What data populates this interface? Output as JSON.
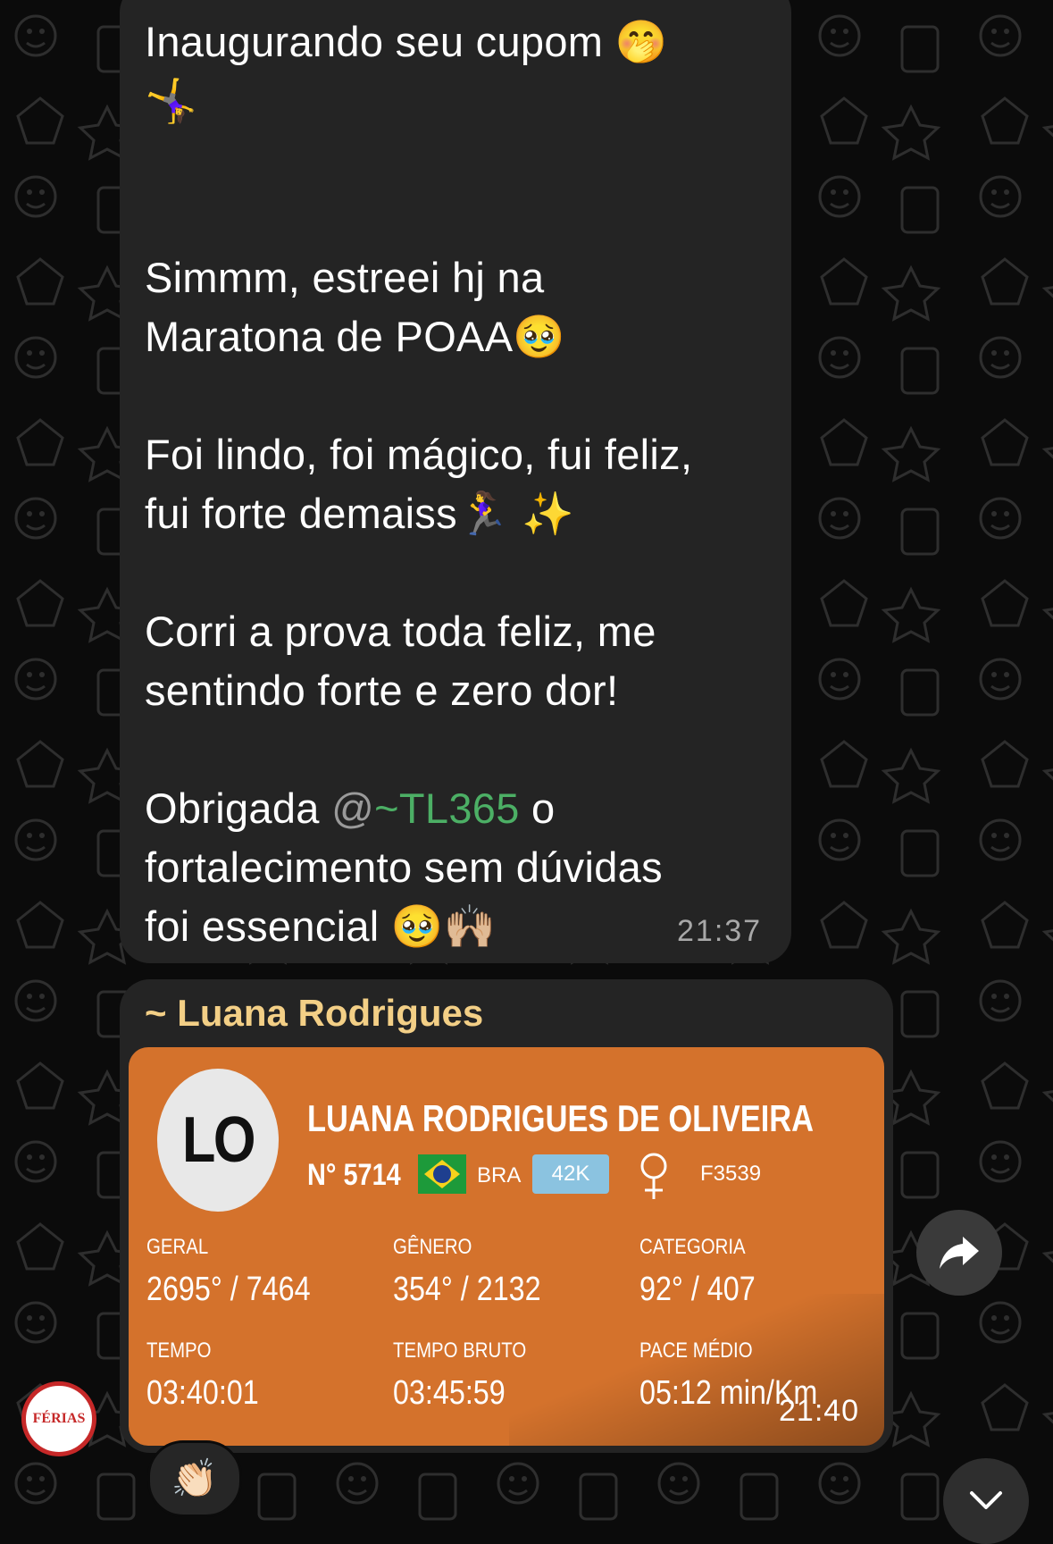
{
  "message1": {
    "line_1": "Inaugurando seu cupom 🤭",
    "line_2": "🤸‍♀️",
    "line_3": "Simmm, estreei hj na",
    "line_4": "Maratona de POAA🥹",
    "line_5": "Foi lindo, foi mágico, fui feliz,",
    "line_6": "fui forte demaiss🏃‍♀️ ✨",
    "line_7": "Corri a prova toda feliz, me",
    "line_8": "sentindo forte e zero dor!",
    "line_9_prefix": "Obrigada ",
    "mention_at": "@",
    "mention_name": "~TL365",
    "line_9_suffix": " o",
    "line_10": "fortalecimento sem dúvidas",
    "line_11": "foi essencial 🥹🙌🏼",
    "time": "21:37"
  },
  "message2": {
    "sender": "~ Luana Rodrigues",
    "time": "21:40",
    "reaction": "👏🏻",
    "card": {
      "initials": "LO",
      "name": "LUANA RODRIGUES DE OLIVEIRA",
      "bib": "N° 5714",
      "country": "BRA",
      "distance": "42K",
      "category_code": "F3539",
      "stats": {
        "geral_label": "GERAL",
        "geral_value": "2695° / 7464",
        "genero_label": "GÊNERO",
        "genero_value": "354° / 2132",
        "categoria_label": "CATEGORIA",
        "categoria_value": "92° / 407",
        "tempo_label": "TEMPO",
        "tempo_value": "03:40:01",
        "bruto_label": "TEMPO BRUTO",
        "bruto_value": "03:45:59",
        "pace_label": "PACE MÉDIO",
        "pace_value": "05:12 min/Km"
      }
    }
  },
  "group_avatar_text": "FÉRIAS",
  "colors": {
    "background": "#0b0b0b",
    "bubble": "#242424",
    "mention": "#4caf65",
    "sender": "#f3cf86",
    "card": "#d4722c",
    "distance_badge": "#8bc3e0"
  },
  "icons": [
    "forward-icon",
    "chevron-down-icon",
    "female-symbol-icon",
    "brazil-flag-icon"
  ]
}
